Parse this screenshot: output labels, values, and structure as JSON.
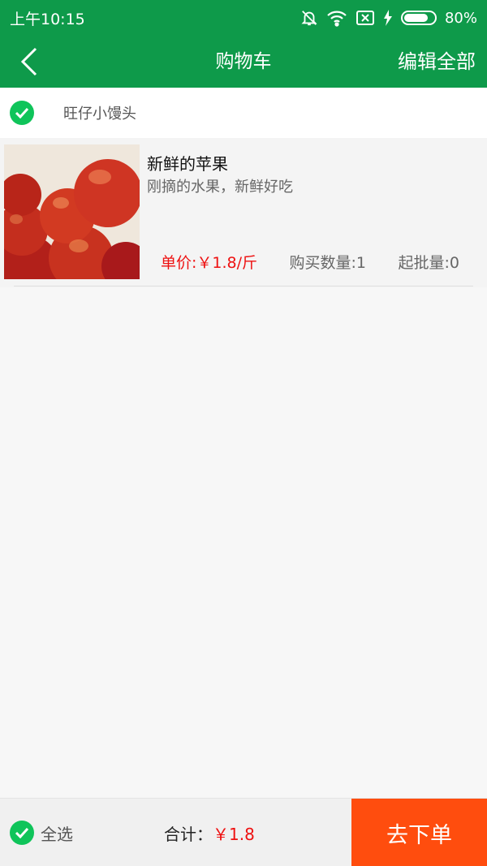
{
  "status_bar": {
    "time": "上午10:15",
    "battery_text": "80%",
    "battery_level": 0.8
  },
  "nav": {
    "title": "购物车",
    "edit_all": "编辑全部"
  },
  "shop": {
    "name": "旺仔小馒头",
    "checked": true
  },
  "product": {
    "name": "新鲜的苹果",
    "description": "刚摘的水果，新鲜好吃",
    "unit_price": "单价:￥1.8/斤",
    "quantity": "购买数量:1",
    "min_batch": "起批量:0"
  },
  "footer": {
    "select_all": "全选",
    "total_label": "合计：",
    "total_value": "￥1.8",
    "checkout": "去下单"
  },
  "colors": {
    "brand_green": "#0e9a4a",
    "check_green": "#0fc45a",
    "price_red": "#ee1111",
    "checkout_orange": "#ff4d0e"
  }
}
